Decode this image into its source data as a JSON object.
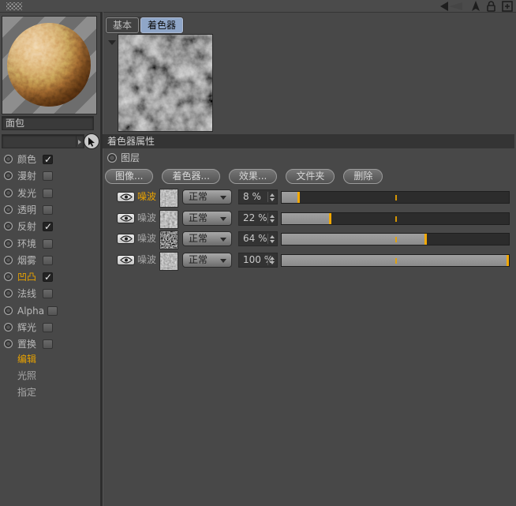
{
  "colors": {
    "accent": "#E8A200",
    "tab_active_bg": "#8FA6C8",
    "slider_fill": "#939393",
    "background": "#484848"
  },
  "topbar": {
    "icon_names": [
      "back-arrow-icon",
      "pointer-up-icon",
      "lock-icon",
      "new-panel-icon"
    ]
  },
  "left_panel": {
    "material_name": "面包",
    "shader_picker_value": "",
    "channels": [
      {
        "label": "颜色",
        "checked": true,
        "active": false
      },
      {
        "label": "漫射",
        "checked": false,
        "active": false
      },
      {
        "label": "发光",
        "checked": false,
        "active": false
      },
      {
        "label": "透明",
        "checked": false,
        "active": false
      },
      {
        "label": "反射",
        "checked": true,
        "active": false
      },
      {
        "label": "环境",
        "checked": false,
        "active": false
      },
      {
        "label": "烟雾",
        "checked": false,
        "active": false
      },
      {
        "label": "凹凸",
        "checked": true,
        "active": true
      },
      {
        "label": "法线",
        "checked": false,
        "active": false
      },
      {
        "label": "Alpha",
        "checked": false,
        "active": false
      },
      {
        "label": "辉光",
        "checked": false,
        "active": false
      },
      {
        "label": "置换",
        "checked": false,
        "active": false
      }
    ],
    "sections": [
      {
        "label": "编辑",
        "active": true
      },
      {
        "label": "光照",
        "active": false
      },
      {
        "label": "指定",
        "active": false
      }
    ]
  },
  "right_panel": {
    "tabs": [
      {
        "label": "基本",
        "active": false
      },
      {
        "label": "着色器",
        "active": true
      }
    ],
    "properties_title": "着色器属性",
    "layers_group_label": "图层",
    "toolbar_buttons": [
      "图像...",
      "着色器...",
      "效果...",
      "文件夹",
      "删除"
    ],
    "layers": [
      {
        "visible": true,
        "name": "噪波",
        "selected": true,
        "blend_mode": "正常",
        "opacity_label": "8 %",
        "opacity": 8
      },
      {
        "visible": true,
        "name": "噪波",
        "selected": false,
        "blend_mode": "正常",
        "opacity_label": "22 %",
        "opacity": 22
      },
      {
        "visible": true,
        "name": "噪波",
        "selected": false,
        "blend_mode": "正常",
        "opacity_label": "64 %",
        "opacity": 64
      },
      {
        "visible": true,
        "name": "噪波",
        "selected": false,
        "blend_mode": "正常",
        "opacity_label": "100 %",
        "opacity": 100
      }
    ]
  }
}
